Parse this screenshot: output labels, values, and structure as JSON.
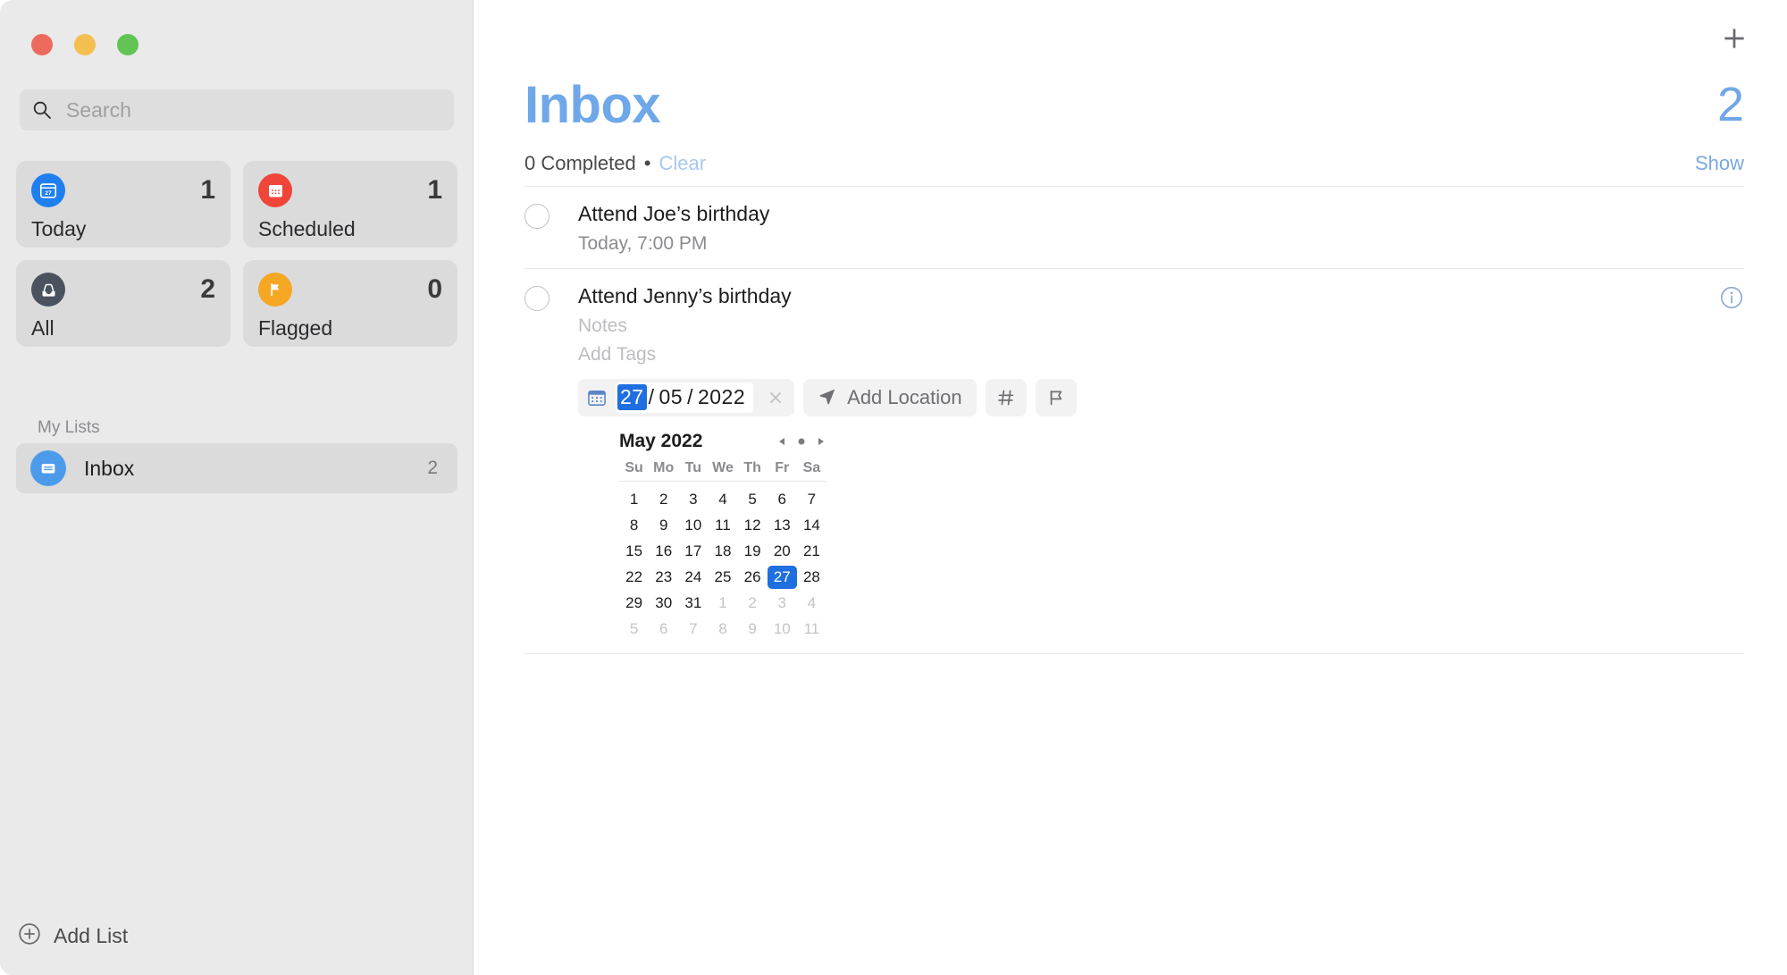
{
  "window": {
    "traffic_lights": [
      "close",
      "minimize",
      "zoom"
    ]
  },
  "sidebar": {
    "search": {
      "placeholder": "Search",
      "value": ""
    },
    "tiles": [
      {
        "label": "Today",
        "count": "1",
        "icon": "calendar-day-icon",
        "color": "#1f7fef"
      },
      {
        "label": "Scheduled",
        "count": "1",
        "icon": "calendar-icon",
        "color": "#f0463a"
      },
      {
        "label": "All",
        "count": "2",
        "icon": "inbox-tray-icon",
        "color": "#4a5260"
      },
      {
        "label": "Flagged",
        "count": "0",
        "icon": "flag-icon",
        "color": "#f5a623"
      }
    ],
    "section_title": "My Lists",
    "lists": [
      {
        "label": "Inbox",
        "count": "2",
        "icon": "inbox-icon",
        "color": "#4c9bea"
      }
    ],
    "add_list_label": "Add List"
  },
  "main": {
    "title": "Inbox",
    "count": "2",
    "completed_text": "0 Completed",
    "separator": "•",
    "clear_label": "Clear",
    "show_label": "Show",
    "add_button": "add-reminder-icon",
    "accent_color": "#6fa8e8",
    "reminders": [
      {
        "title": "Attend Joe’s birthday",
        "subtitle": "Today, 7:00 PM",
        "editing": false
      },
      {
        "title": "Attend Jenny’s birthday",
        "notes_placeholder": "Notes",
        "tags_placeholder": "Add Tags",
        "editing": true,
        "has_info_button": true
      }
    ],
    "editor": {
      "date": {
        "day": "27",
        "month": "05",
        "year": "2022",
        "selected_segment": "day"
      },
      "date_sep": "/",
      "clear_date_icon": "close-icon",
      "calendar_icon": "calendar-small-icon",
      "add_location_label": "Add Location",
      "location_icon": "location-arrow-icon",
      "tag_button_icon": "hash-icon",
      "flag_button_icon": "flag-outline-icon"
    },
    "calendar": {
      "month_label": "May 2022",
      "prev_icon": "triangle-left-icon",
      "today_icon": "dot-icon",
      "next_icon": "triangle-right-icon",
      "day_headers": [
        "Su",
        "Mo",
        "Tu",
        "We",
        "Th",
        "Fr",
        "Sa"
      ],
      "weeks": [
        [
          {
            "d": "1",
            "m": false
          },
          {
            "d": "2",
            "m": false
          },
          {
            "d": "3",
            "m": false
          },
          {
            "d": "4",
            "m": false
          },
          {
            "d": "5",
            "m": false
          },
          {
            "d": "6",
            "m": false
          },
          {
            "d": "7",
            "m": false
          }
        ],
        [
          {
            "d": "8",
            "m": false
          },
          {
            "d": "9",
            "m": false
          },
          {
            "d": "10",
            "m": false
          },
          {
            "d": "11",
            "m": false
          },
          {
            "d": "12",
            "m": false
          },
          {
            "d": "13",
            "m": false
          },
          {
            "d": "14",
            "m": false
          }
        ],
        [
          {
            "d": "15",
            "m": false
          },
          {
            "d": "16",
            "m": false
          },
          {
            "d": "17",
            "m": false
          },
          {
            "d": "18",
            "m": false
          },
          {
            "d": "19",
            "m": false
          },
          {
            "d": "20",
            "m": false
          },
          {
            "d": "21",
            "m": false
          }
        ],
        [
          {
            "d": "22",
            "m": false
          },
          {
            "d": "23",
            "m": false
          },
          {
            "d": "24",
            "m": false
          },
          {
            "d": "25",
            "m": false
          },
          {
            "d": "26",
            "m": false
          },
          {
            "d": "27",
            "m": false,
            "sel": true
          },
          {
            "d": "28",
            "m": false
          }
        ],
        [
          {
            "d": "29",
            "m": false
          },
          {
            "d": "30",
            "m": false
          },
          {
            "d": "31",
            "m": false
          },
          {
            "d": "1",
            "m": true
          },
          {
            "d": "2",
            "m": true
          },
          {
            "d": "3",
            "m": true
          },
          {
            "d": "4",
            "m": true
          }
        ],
        [
          {
            "d": "5",
            "m": true
          },
          {
            "d": "6",
            "m": true
          },
          {
            "d": "7",
            "m": true
          },
          {
            "d": "8",
            "m": true
          },
          {
            "d": "9",
            "m": true
          },
          {
            "d": "10",
            "m": true
          },
          {
            "d": "11",
            "m": true
          }
        ]
      ],
      "selected_day": "27"
    }
  }
}
